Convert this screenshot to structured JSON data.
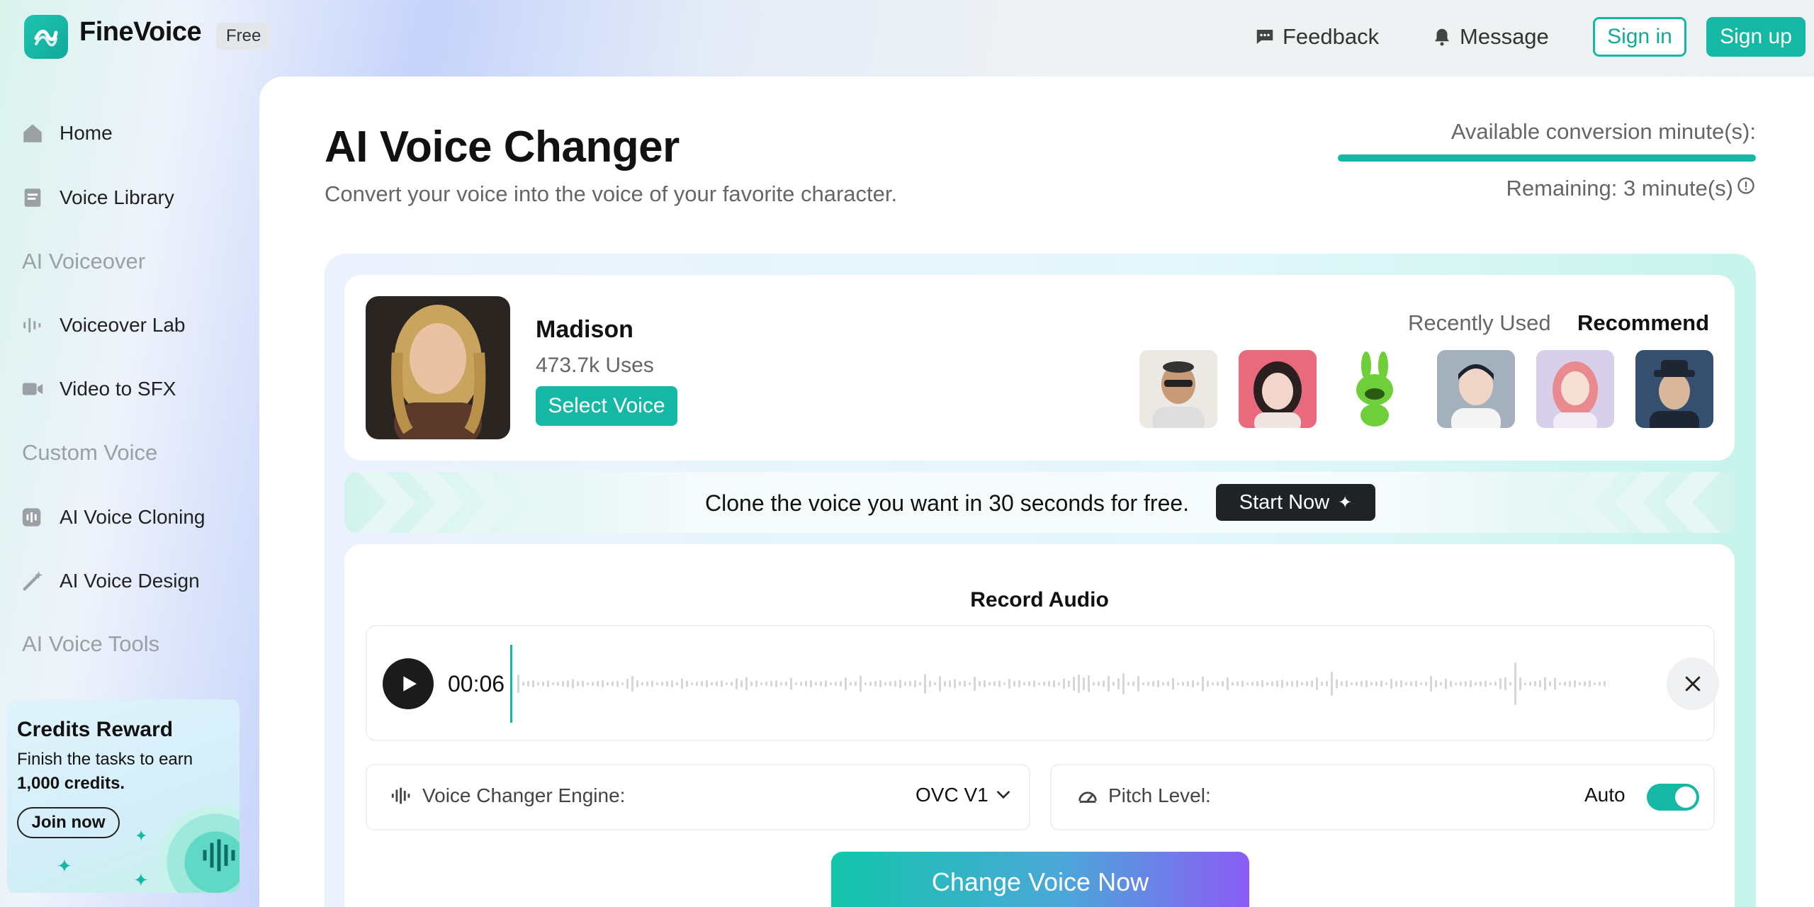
{
  "app": {
    "name": "FineVoice",
    "plan_badge": "Free",
    "brand_color": "#14b8a4"
  },
  "header": {
    "feedback_label": "Feedback",
    "message_label": "Message",
    "signin_label": "Sign in",
    "signup_label": "Sign up"
  },
  "sidebar": {
    "items": [
      {
        "label": "Home",
        "icon": "home-icon"
      },
      {
        "label": "Voice Library",
        "icon": "book-icon"
      },
      {
        "label": "Voiceover Lab",
        "icon": "soundwave-icon"
      },
      {
        "label": "Video to SFX",
        "icon": "video-camera-icon"
      },
      {
        "label": "AI Voice Cloning",
        "icon": "voice-clone-icon"
      },
      {
        "label": "AI Voice Design",
        "icon": "magic-wand-icon"
      }
    ],
    "sections": [
      "AI Voiceover",
      "Custom Voice",
      "AI Voice Tools"
    ],
    "credits": {
      "title": "Credits Reward",
      "desc_prefix": "Finish the tasks to earn",
      "desc_bold": "1,000 credits.",
      "join_label": "Join now"
    }
  },
  "main": {
    "title": "AI Voice Changer",
    "subtitle": "Convert your voice into the voice of your favorite character.",
    "minutes": {
      "label": "Available conversion minute(s):",
      "remaining": "Remaining: 3 minute(s)",
      "fill_fraction": 1.0
    },
    "voice": {
      "name": "Madison",
      "uses": "473.7k Uses",
      "select_label": "Select Voice"
    },
    "voice_tabs": {
      "recent": "Recently Used",
      "recommend": "Recommend"
    },
    "voice_thumbs": [
      "man-sunglasses",
      "girl-pink",
      "green-bunny",
      "young-man",
      "girl-pink-hair",
      "man-fedora"
    ],
    "clone_banner": {
      "text": "Clone the voice you want in 30 seconds for free.",
      "button": "Start Now"
    },
    "record": {
      "title": "Record Audio",
      "time": "00:06"
    },
    "engine": {
      "label": "Voice Changer Engine:",
      "value": "OVC V1"
    },
    "pitch": {
      "label": "Pitch Level:",
      "value": "Auto",
      "toggle_on": true
    },
    "change_button": "Change Voice Now"
  }
}
